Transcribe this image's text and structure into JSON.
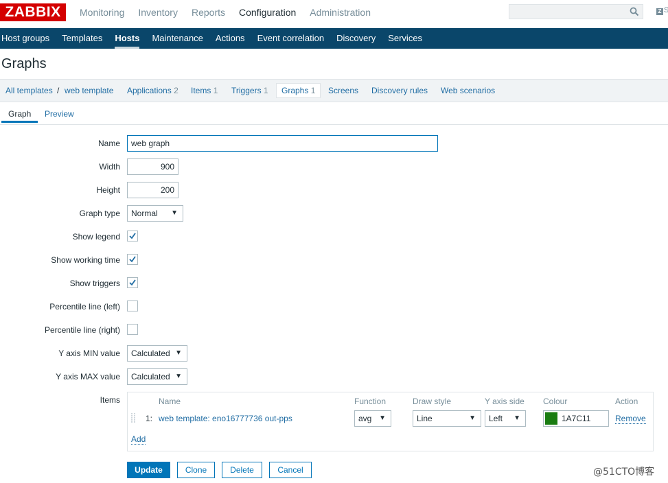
{
  "logo": "ZABBIX",
  "top_menu": [
    "Monitoring",
    "Inventory",
    "Reports",
    "Configuration",
    "Administration"
  ],
  "search": {
    "placeholder": ""
  },
  "zbx_icon": "Z",
  "zbx_s": "S",
  "sub_menu": [
    "Host groups",
    "Templates",
    "Hosts",
    "Maintenance",
    "Actions",
    "Event correlation",
    "Discovery",
    "Services"
  ],
  "page_title": "Graphs",
  "breadcrumbs": {
    "all_templates": "All templates",
    "separator": "/",
    "template": "web template",
    "applications": "Applications",
    "applications_count": "2",
    "items": "Items",
    "items_count": "1",
    "triggers": "Triggers",
    "triggers_count": "1",
    "graphs": "Graphs",
    "graphs_count": "1",
    "screens": "Screens",
    "discovery_rules": "Discovery rules",
    "web_scenarios": "Web scenarios"
  },
  "tabs": {
    "graph": "Graph",
    "preview": "Preview"
  },
  "form": {
    "name_label": "Name",
    "name_value": "web graph",
    "width_label": "Width",
    "width_value": "900",
    "height_label": "Height",
    "height_value": "200",
    "graph_type_label": "Graph type",
    "graph_type_value": "Normal",
    "show_legend_label": "Show legend",
    "show_legend": true,
    "show_working_time_label": "Show working time",
    "show_working_time": true,
    "show_triggers_label": "Show triggers",
    "show_triggers": true,
    "percentile_left_label": "Percentile line (left)",
    "percentile_left": false,
    "percentile_right_label": "Percentile line (right)",
    "percentile_right": false,
    "y_min_label": "Y axis MIN value",
    "y_min_value": "Calculated",
    "y_max_label": "Y axis MAX value",
    "y_max_value": "Calculated",
    "items_label": "Items"
  },
  "items_table": {
    "headers": {
      "name": "Name",
      "function": "Function",
      "draw_style": "Draw style",
      "y_axis_side": "Y axis side",
      "colour": "Colour",
      "action": "Action"
    },
    "rows": [
      {
        "index": "1:",
        "name": "web template: eno16777736 out-pps",
        "function": "avg",
        "draw_style": "Line",
        "y_axis_side": "Left",
        "colour_hex": "#1A7C11",
        "colour": "1A7C11",
        "action": "Remove"
      }
    ],
    "add": "Add"
  },
  "buttons": {
    "update": "Update",
    "clone": "Clone",
    "delete": "Delete",
    "cancel": "Cancel"
  },
  "watermark": "@51CTO博客"
}
